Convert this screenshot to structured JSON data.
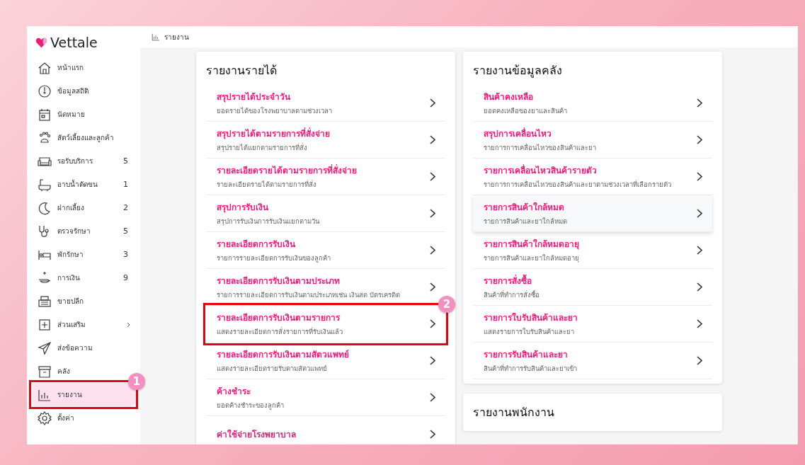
{
  "brand": {
    "name": "Vettale"
  },
  "breadcrumb": {
    "label": "รายงาน"
  },
  "sidebar": {
    "items": [
      {
        "label": "หน้าแรก",
        "kind": "home",
        "selected": false,
        "expandable": false
      },
      {
        "label": "ข้อมูลสถิติ",
        "kind": "gauge",
        "selected": false,
        "expandable": false
      },
      {
        "label": "นัดหมาย",
        "kind": "calendar",
        "selected": false,
        "expandable": false
      },
      {
        "label": "สัตว์เลี้ยงและลูกค้า",
        "kind": "paw",
        "selected": false,
        "expandable": false
      },
      {
        "label": "รอรับบริการ",
        "kind": "sofa",
        "count": "5",
        "selected": false,
        "expandable": false
      },
      {
        "label": "อาบน้ำตัดขน",
        "kind": "bath",
        "count": "1",
        "selected": false,
        "expandable": false
      },
      {
        "label": "ฝากเลี้ยง",
        "kind": "moon",
        "count": "2",
        "selected": false,
        "expandable": false
      },
      {
        "label": "ตรวจรักษา",
        "kind": "stethoscope",
        "count": "5",
        "selected": false,
        "expandable": false
      },
      {
        "label": "พักรักษา",
        "kind": "bed",
        "count": "3",
        "selected": false,
        "expandable": false
      },
      {
        "label": "การเงิน",
        "kind": "money",
        "count": "9",
        "selected": false,
        "expandable": false
      },
      {
        "label": "ขายปลีก",
        "kind": "register",
        "selected": false,
        "expandable": false
      },
      {
        "label": "ส่วนเสริม",
        "kind": "plus",
        "selected": false,
        "expandable": true
      },
      {
        "label": "ส่งข้อความ",
        "kind": "plane",
        "selected": false,
        "expandable": false
      },
      {
        "label": "คลัง",
        "kind": "box",
        "selected": false,
        "expandable": false
      },
      {
        "label": "รายงาน",
        "kind": "chart",
        "selected": true,
        "expandable": false,
        "callout": "1"
      },
      {
        "label": "ตั้งค่า",
        "kind": "gear",
        "selected": false,
        "expandable": false
      }
    ]
  },
  "cards": [
    {
      "title": "รายงานรายได้",
      "items": [
        {
          "title": "สรุปรายได้ประจำวัน",
          "subtitle": "ยอดรายได้ของโรงพยาบาลตามช่วงเวลา",
          "highlighted": false
        },
        {
          "title": "สรุปรายได้ตามรายการที่สั่งจ่าย",
          "subtitle": "สรุปรายได้แยกตามรายการที่สั่ง",
          "highlighted": false
        },
        {
          "title": "รายละเอียดรายได้ตามรายการที่สั่งจ่าย",
          "subtitle": "รายละเอียดรายได้ตามรายการที่สั่ง",
          "highlighted": false
        },
        {
          "title": "สรุปการรับเงิน",
          "subtitle": "สรุปการรับเงินการรับเงินแยกตามวัน",
          "highlighted": false
        },
        {
          "title": "รายละเอียดการรับเงิน",
          "subtitle": "รายการรายละเอียดการรับเงินของลูกค้า",
          "highlighted": false
        },
        {
          "title": "รายละเอียดการรับเงินตามประเภท",
          "subtitle": "รายการรายละเอียดการรับเงินตามประเภทเช่น เงินสด บัตรเครดิต",
          "highlighted": false
        },
        {
          "title": "รายละเอียดการรับเงินตามรายการ",
          "subtitle": "แสดงรายละเอียดการสั่งรายการที่รับเงินแล้ว",
          "highlighted": false,
          "callout": "2"
        },
        {
          "title": "รายละเอียดการรับเงินตามสัตวแพทย์",
          "subtitle": "แสดงรายละเอียดรายรับตามสัตวแพทย์",
          "highlighted": false
        },
        {
          "title": "ค้างชำระ",
          "subtitle": "ยอดค้างชำระของลูกค้า",
          "highlighted": false
        },
        {
          "title": "ค่าใช้จ่ายโรงพยาบาล",
          "highlighted": false
        }
      ]
    },
    {
      "title": "รายงานข้อมูลคลัง",
      "items": [
        {
          "title": "สินค้าคงเหลือ",
          "subtitle": "ยอดคงเหลือของยาและสินค้า",
          "highlighted": false
        },
        {
          "title": "สรุปการเคลื่อนไหว",
          "subtitle": "รายการการเคลื่อนไหวของสินค้าและยา",
          "highlighted": false
        },
        {
          "title": "รายการเคลื่อนไหวสินค้ารายตัว",
          "subtitle": "รายการการเคลื่อนไหวของสินค้าและยาตามช่วงเวลาที่เลือกรายตัว",
          "highlighted": false
        },
        {
          "title": "รายการสินค้าใกล้หมด",
          "subtitle": "รายการสินค้าและยาใกล้หมด",
          "highlighted": true
        },
        {
          "title": "รายการสินค้าใกล้หมดอายุ",
          "subtitle": "รายการสินค้าและยาใกล้หมดอายุ",
          "highlighted": false
        },
        {
          "title": "รายการสั่งซื้อ",
          "subtitle": "สินค้าที่ทำการสั่งซื้อ",
          "highlighted": false
        },
        {
          "title": "รายการใบรับสินค้าและยา",
          "subtitle": "แสดงรายการใบรับสินค้าและยา",
          "highlighted": false
        },
        {
          "title": "รายการรับสินค้าและยา",
          "subtitle": "สินค้าที่ทำการรับสินค้าและยาเข้า",
          "highlighted": false
        }
      ]
    },
    {
      "title": "รายงานพนักงาน"
    }
  ]
}
